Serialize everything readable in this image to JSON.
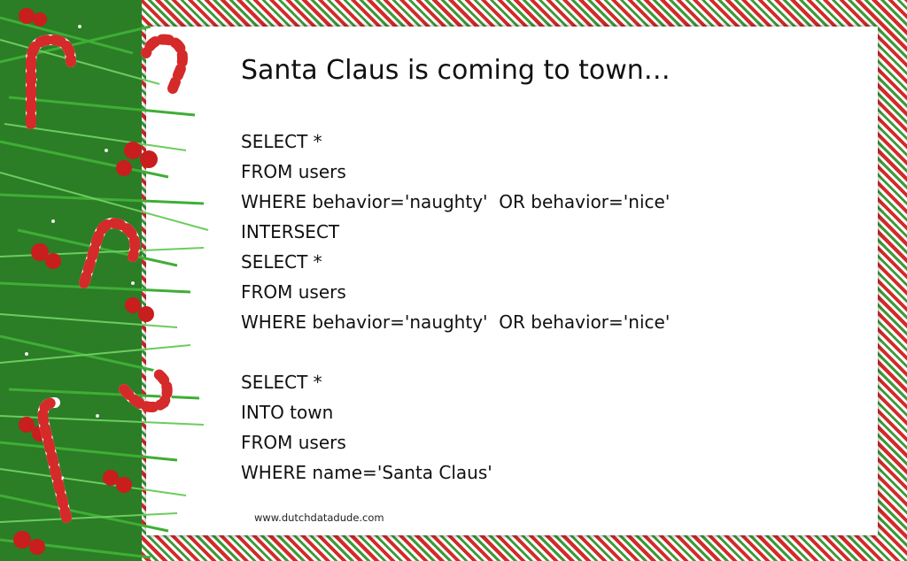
{
  "title": "Santa Claus is coming to town…",
  "query_one": [
    "SELECT *",
    "FROM users",
    "WHERE behavior='naughty'  OR behavior='nice'",
    "INTERSECT",
    "SELECT *",
    "FROM users",
    "WHERE behavior='naughty'  OR behavior='nice'"
  ],
  "query_two": [
    "SELECT *",
    "INTO town",
    "FROM users",
    "WHERE name='Santa Claus'"
  ],
  "website": "www.dutchdatadude.com",
  "colors": {
    "stripe_red": "#d42a2a",
    "stripe_green": "#3d9a3a",
    "pine": "#2f8a2a",
    "berry": "#c81e1e"
  }
}
